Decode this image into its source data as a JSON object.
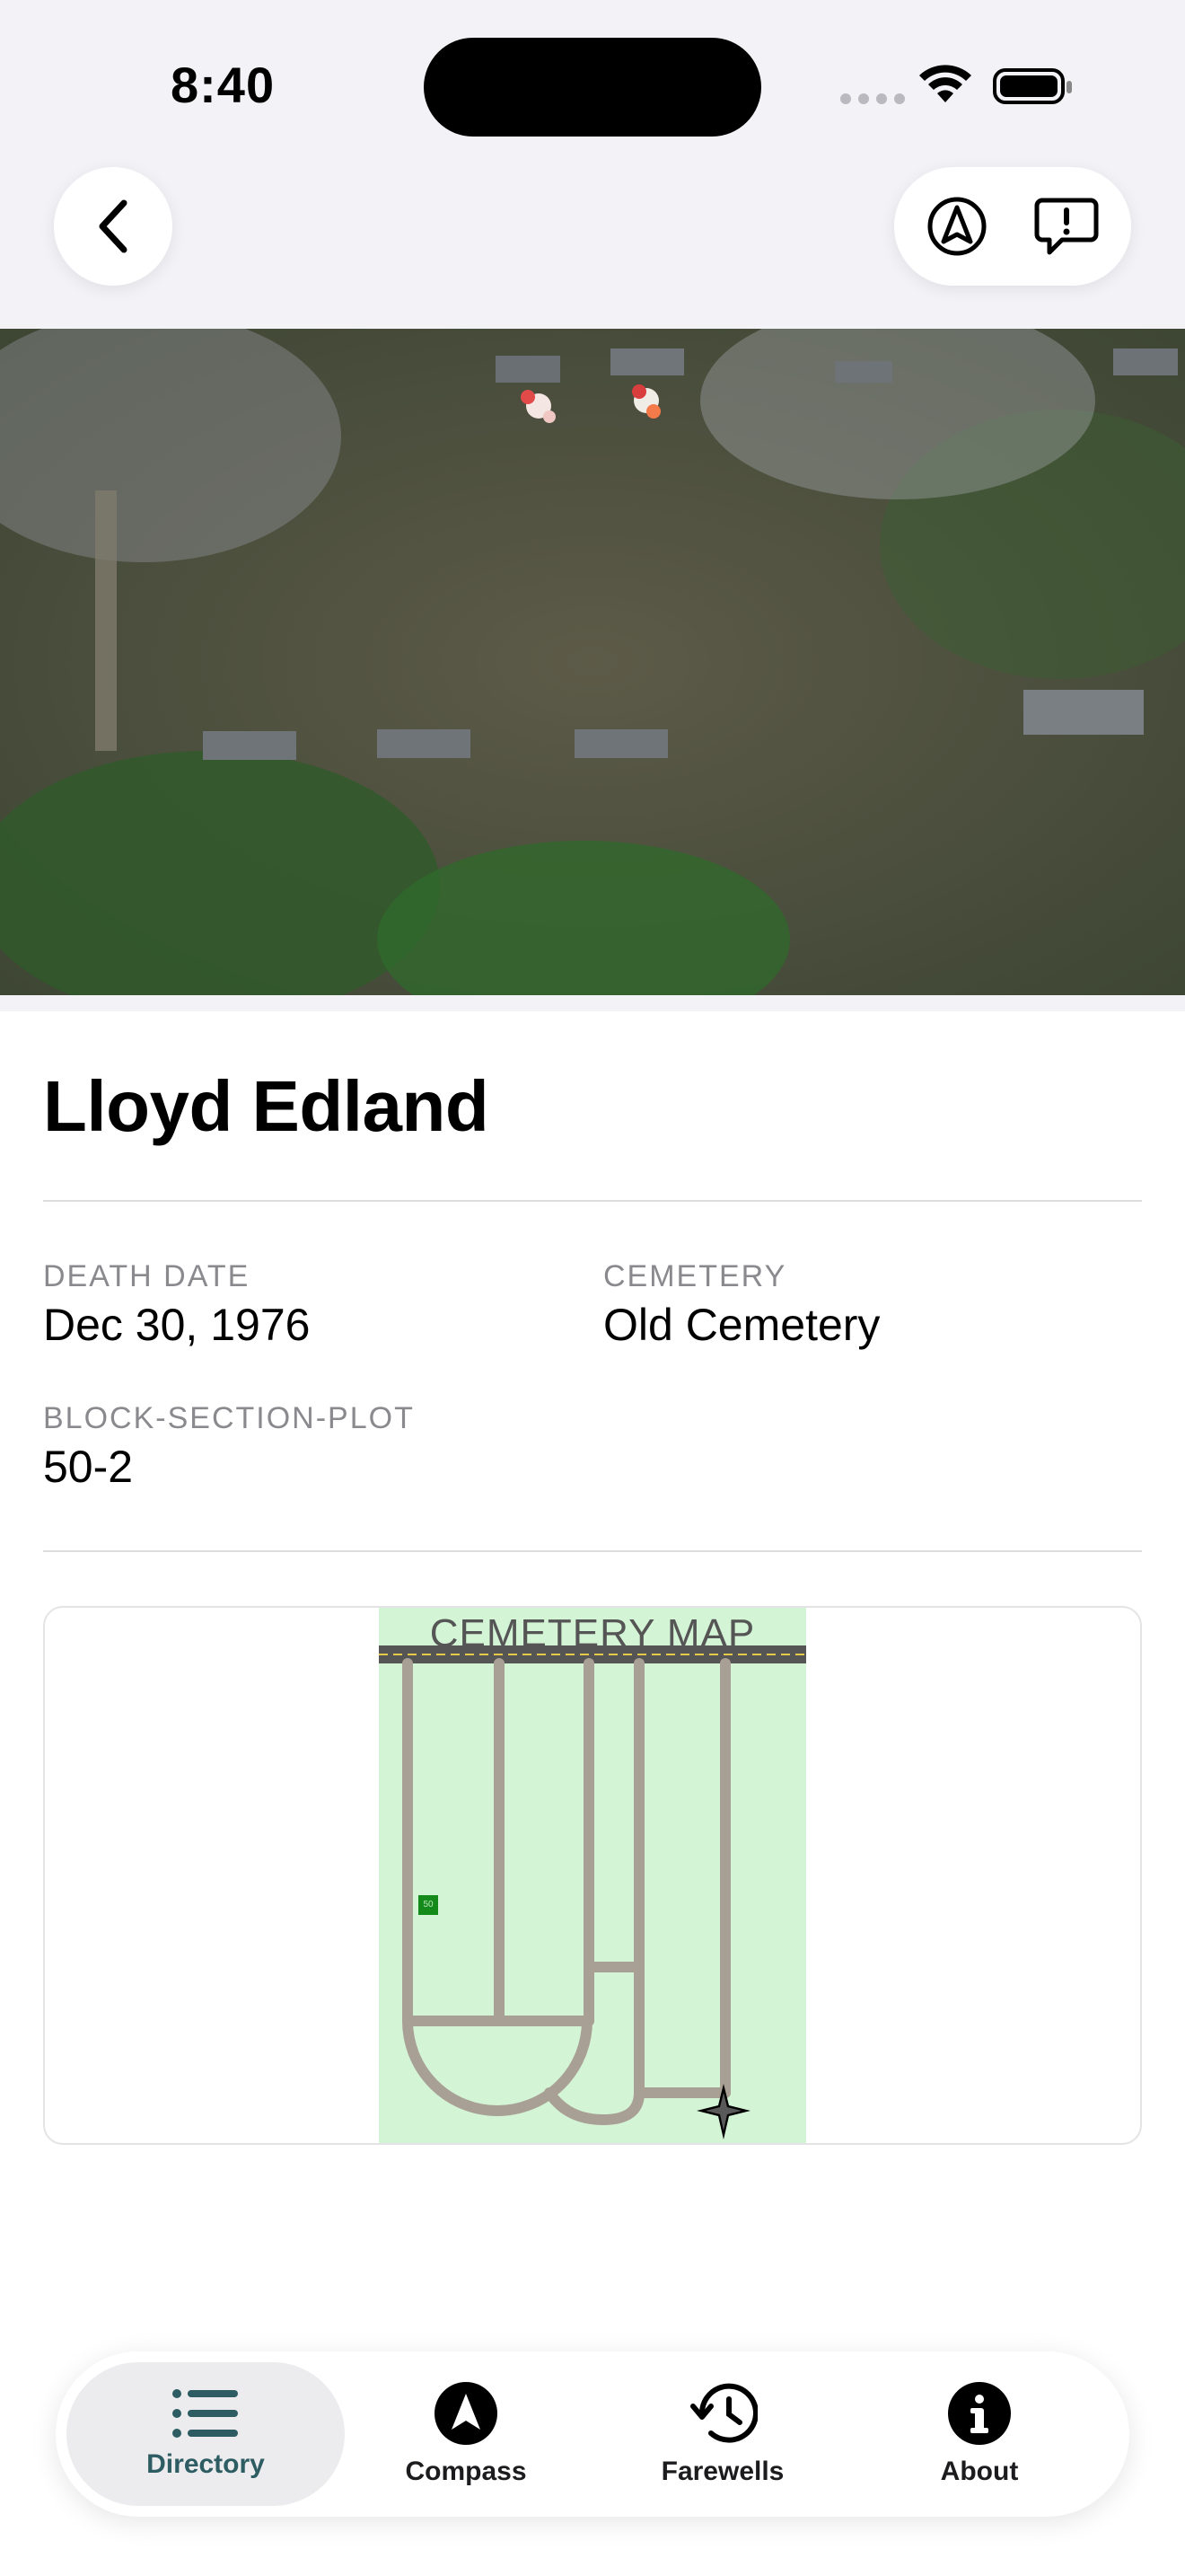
{
  "status_bar": {
    "time": "8:40"
  },
  "nav": {
    "back_icon": "chevron-left-icon",
    "actions": [
      "location-arrow-icon",
      "report-issue-icon"
    ]
  },
  "record": {
    "name": "Lloyd Edland",
    "fields": {
      "death_date": {
        "label": "DEATH DATE",
        "value": "Dec 30, 1976"
      },
      "cemetery": {
        "label": "CEMETERY",
        "value": "Old Cemetery"
      },
      "plot": {
        "label": "BLOCK-SECTION-PLOT",
        "value": "50-2"
      }
    }
  },
  "map": {
    "title": "CEMETERY MAP",
    "marker_label": "50",
    "colors": {
      "background": "#d4f4d6",
      "paths": "#a89f95",
      "marker": "#138a1a"
    }
  },
  "tabbar": {
    "tabs": [
      {
        "label": "Directory",
        "icon": "list-icon",
        "active": true
      },
      {
        "label": "Compass",
        "icon": "compass-arrow-icon",
        "active": false
      },
      {
        "label": "Farewells",
        "icon": "history-clock-icon",
        "active": false
      },
      {
        "label": "About",
        "icon": "info-icon",
        "active": false
      }
    ],
    "accent": "#2d5d63"
  }
}
